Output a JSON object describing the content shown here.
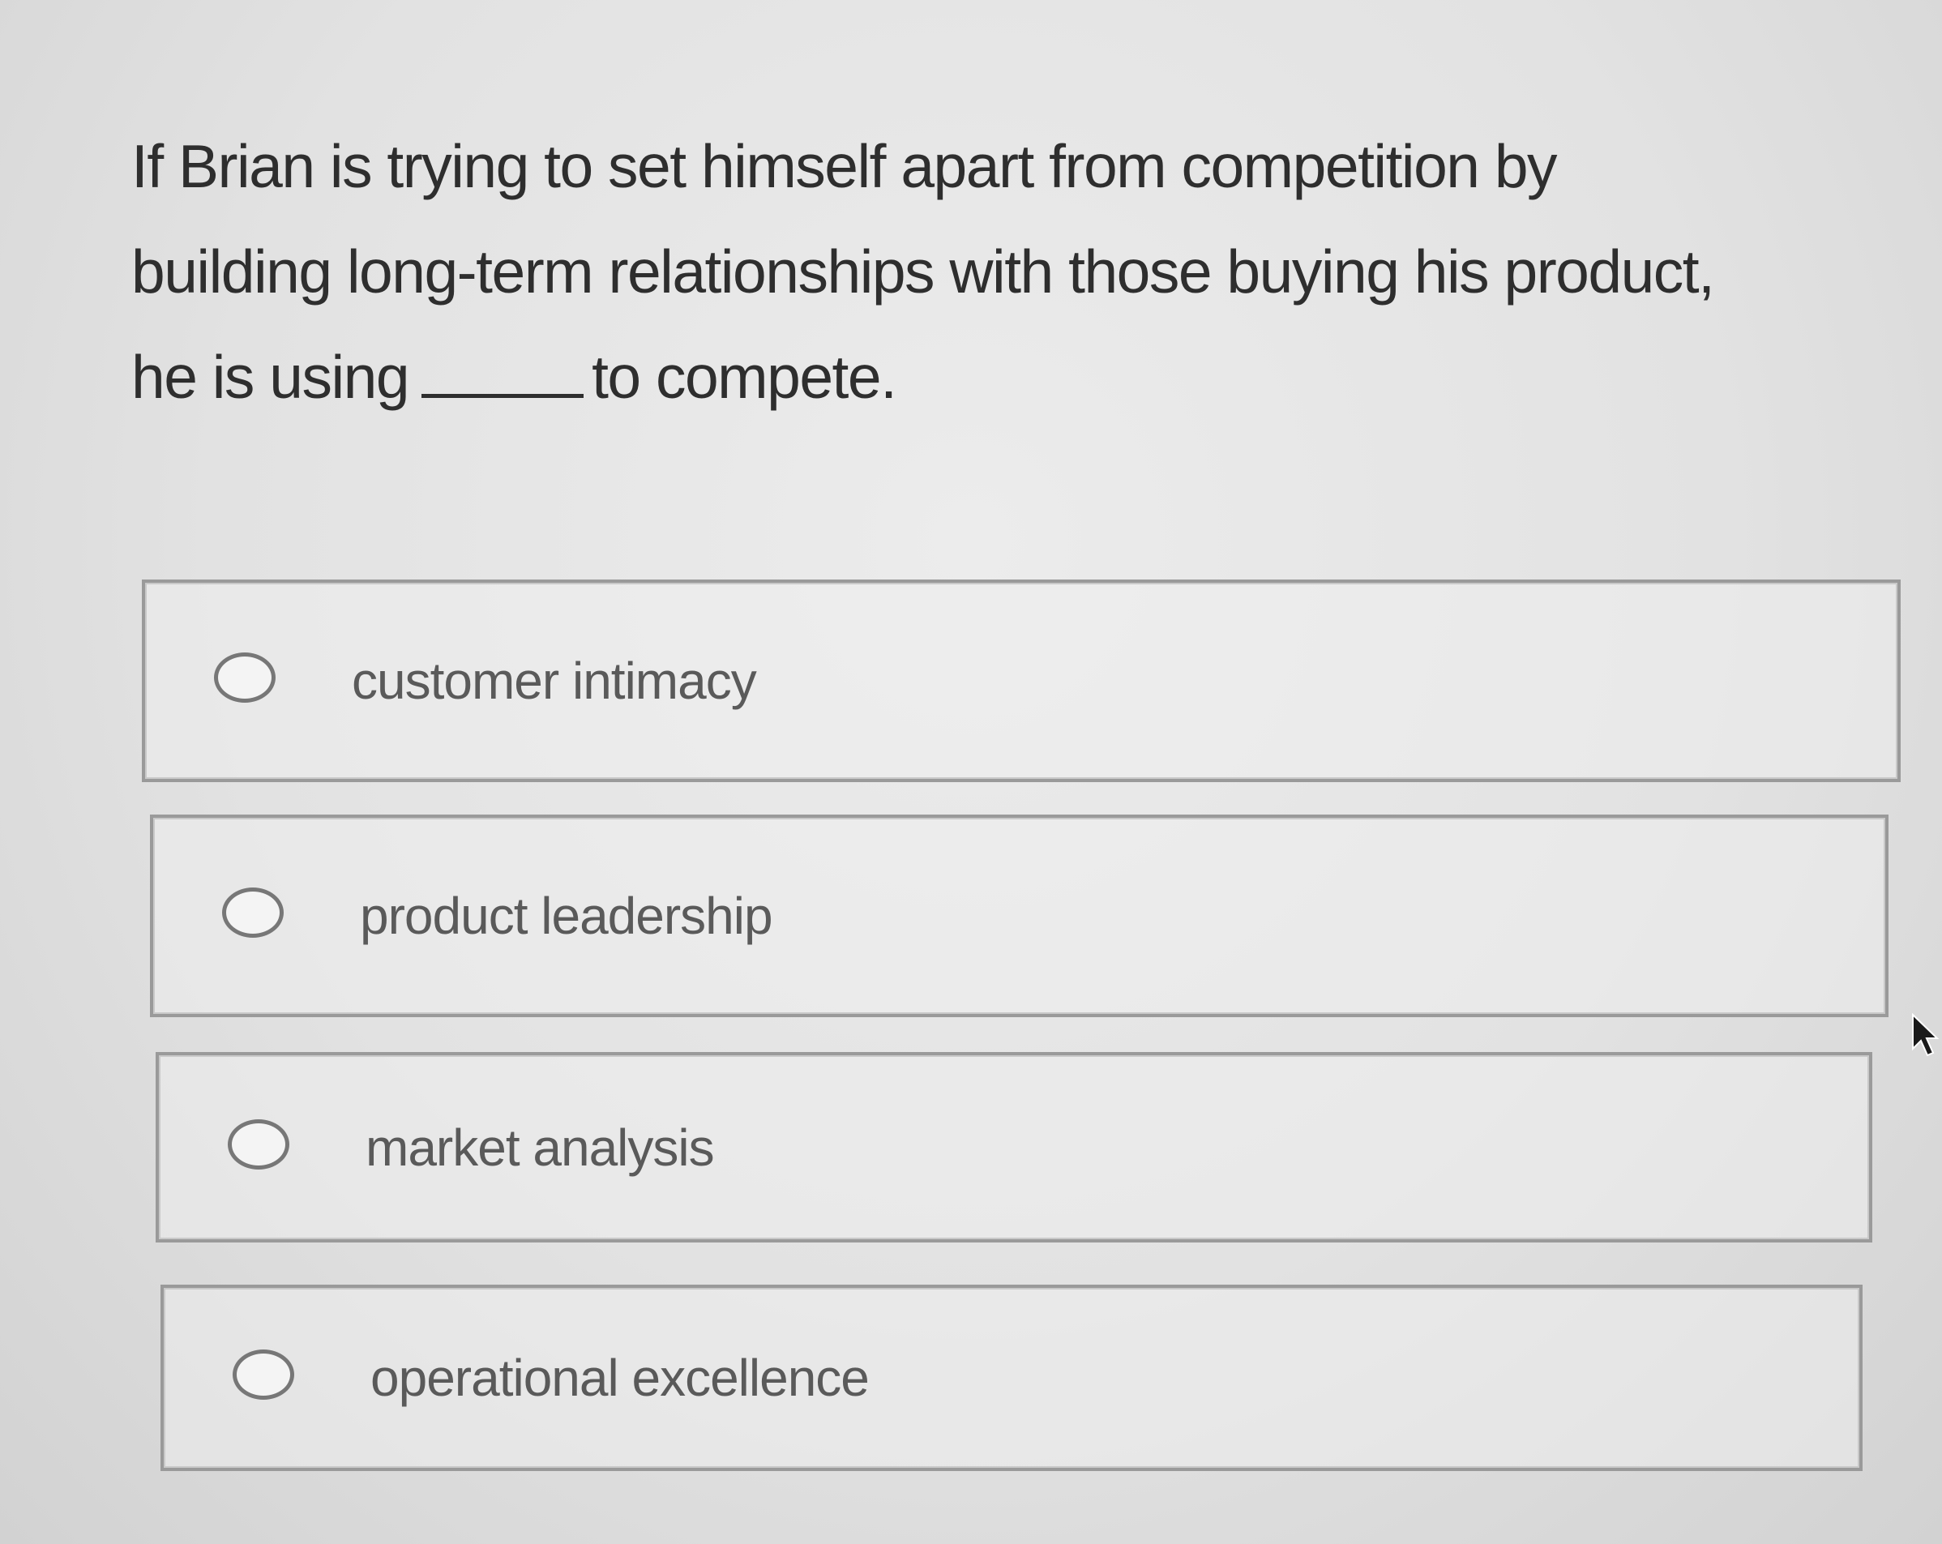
{
  "question": {
    "line1": "If Brian is trying to set himself apart from competition by",
    "line2": "building long-term relationships with those buying his product,",
    "line3_before": "he is using",
    "line3_after": "to compete."
  },
  "options": [
    {
      "label": "customer intimacy",
      "selected": false
    },
    {
      "label": "product leadership",
      "selected": false
    },
    {
      "label": "market analysis",
      "selected": false
    },
    {
      "label": "operational excellence",
      "selected": false
    }
  ],
  "colors": {
    "text": "#2e2e2e",
    "option_text": "#5a5a5a",
    "border": "#9a9a9a",
    "background": "#e2e2e2"
  },
  "icons": {
    "radio": "radio-button-empty-icon",
    "cursor": "mouse-pointer-icon"
  }
}
